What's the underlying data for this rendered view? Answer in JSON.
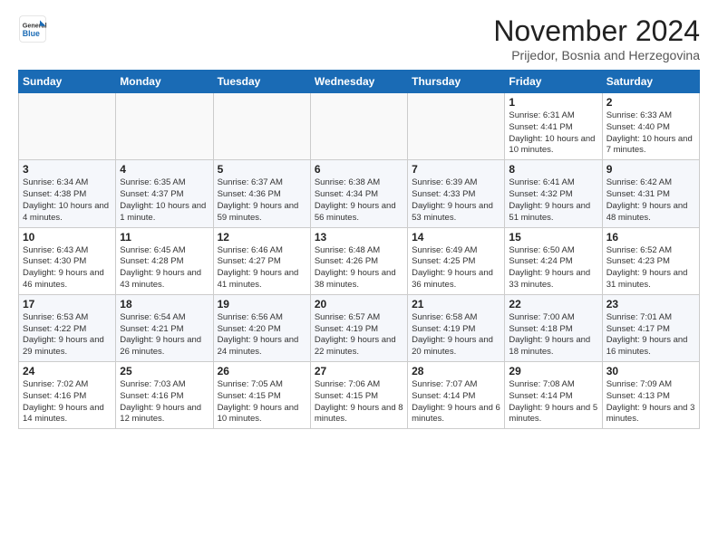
{
  "logo": {
    "general": "General",
    "blue": "Blue"
  },
  "title": "November 2024",
  "location": "Prijedor, Bosnia and Herzegovina",
  "days_of_week": [
    "Sunday",
    "Monday",
    "Tuesday",
    "Wednesday",
    "Thursday",
    "Friday",
    "Saturday"
  ],
  "weeks": [
    [
      {
        "day": "",
        "info": ""
      },
      {
        "day": "",
        "info": ""
      },
      {
        "day": "",
        "info": ""
      },
      {
        "day": "",
        "info": ""
      },
      {
        "day": "",
        "info": ""
      },
      {
        "day": "1",
        "info": "Sunrise: 6:31 AM\nSunset: 4:41 PM\nDaylight: 10 hours and 10 minutes."
      },
      {
        "day": "2",
        "info": "Sunrise: 6:33 AM\nSunset: 4:40 PM\nDaylight: 10 hours and 7 minutes."
      }
    ],
    [
      {
        "day": "3",
        "info": "Sunrise: 6:34 AM\nSunset: 4:38 PM\nDaylight: 10 hours and 4 minutes."
      },
      {
        "day": "4",
        "info": "Sunrise: 6:35 AM\nSunset: 4:37 PM\nDaylight: 10 hours and 1 minute."
      },
      {
        "day": "5",
        "info": "Sunrise: 6:37 AM\nSunset: 4:36 PM\nDaylight: 9 hours and 59 minutes."
      },
      {
        "day": "6",
        "info": "Sunrise: 6:38 AM\nSunset: 4:34 PM\nDaylight: 9 hours and 56 minutes."
      },
      {
        "day": "7",
        "info": "Sunrise: 6:39 AM\nSunset: 4:33 PM\nDaylight: 9 hours and 53 minutes."
      },
      {
        "day": "8",
        "info": "Sunrise: 6:41 AM\nSunset: 4:32 PM\nDaylight: 9 hours and 51 minutes."
      },
      {
        "day": "9",
        "info": "Sunrise: 6:42 AM\nSunset: 4:31 PM\nDaylight: 9 hours and 48 minutes."
      }
    ],
    [
      {
        "day": "10",
        "info": "Sunrise: 6:43 AM\nSunset: 4:30 PM\nDaylight: 9 hours and 46 minutes."
      },
      {
        "day": "11",
        "info": "Sunrise: 6:45 AM\nSunset: 4:28 PM\nDaylight: 9 hours and 43 minutes."
      },
      {
        "day": "12",
        "info": "Sunrise: 6:46 AM\nSunset: 4:27 PM\nDaylight: 9 hours and 41 minutes."
      },
      {
        "day": "13",
        "info": "Sunrise: 6:48 AM\nSunset: 4:26 PM\nDaylight: 9 hours and 38 minutes."
      },
      {
        "day": "14",
        "info": "Sunrise: 6:49 AM\nSunset: 4:25 PM\nDaylight: 9 hours and 36 minutes."
      },
      {
        "day": "15",
        "info": "Sunrise: 6:50 AM\nSunset: 4:24 PM\nDaylight: 9 hours and 33 minutes."
      },
      {
        "day": "16",
        "info": "Sunrise: 6:52 AM\nSunset: 4:23 PM\nDaylight: 9 hours and 31 minutes."
      }
    ],
    [
      {
        "day": "17",
        "info": "Sunrise: 6:53 AM\nSunset: 4:22 PM\nDaylight: 9 hours and 29 minutes."
      },
      {
        "day": "18",
        "info": "Sunrise: 6:54 AM\nSunset: 4:21 PM\nDaylight: 9 hours and 26 minutes."
      },
      {
        "day": "19",
        "info": "Sunrise: 6:56 AM\nSunset: 4:20 PM\nDaylight: 9 hours and 24 minutes."
      },
      {
        "day": "20",
        "info": "Sunrise: 6:57 AM\nSunset: 4:19 PM\nDaylight: 9 hours and 22 minutes."
      },
      {
        "day": "21",
        "info": "Sunrise: 6:58 AM\nSunset: 4:19 PM\nDaylight: 9 hours and 20 minutes."
      },
      {
        "day": "22",
        "info": "Sunrise: 7:00 AM\nSunset: 4:18 PM\nDaylight: 9 hours and 18 minutes."
      },
      {
        "day": "23",
        "info": "Sunrise: 7:01 AM\nSunset: 4:17 PM\nDaylight: 9 hours and 16 minutes."
      }
    ],
    [
      {
        "day": "24",
        "info": "Sunrise: 7:02 AM\nSunset: 4:16 PM\nDaylight: 9 hours and 14 minutes."
      },
      {
        "day": "25",
        "info": "Sunrise: 7:03 AM\nSunset: 4:16 PM\nDaylight: 9 hours and 12 minutes."
      },
      {
        "day": "26",
        "info": "Sunrise: 7:05 AM\nSunset: 4:15 PM\nDaylight: 9 hours and 10 minutes."
      },
      {
        "day": "27",
        "info": "Sunrise: 7:06 AM\nSunset: 4:15 PM\nDaylight: 9 hours and 8 minutes."
      },
      {
        "day": "28",
        "info": "Sunrise: 7:07 AM\nSunset: 4:14 PM\nDaylight: 9 hours and 6 minutes."
      },
      {
        "day": "29",
        "info": "Sunrise: 7:08 AM\nSunset: 4:14 PM\nDaylight: 9 hours and 5 minutes."
      },
      {
        "day": "30",
        "info": "Sunrise: 7:09 AM\nSunset: 4:13 PM\nDaylight: 9 hours and 3 minutes."
      }
    ]
  ]
}
